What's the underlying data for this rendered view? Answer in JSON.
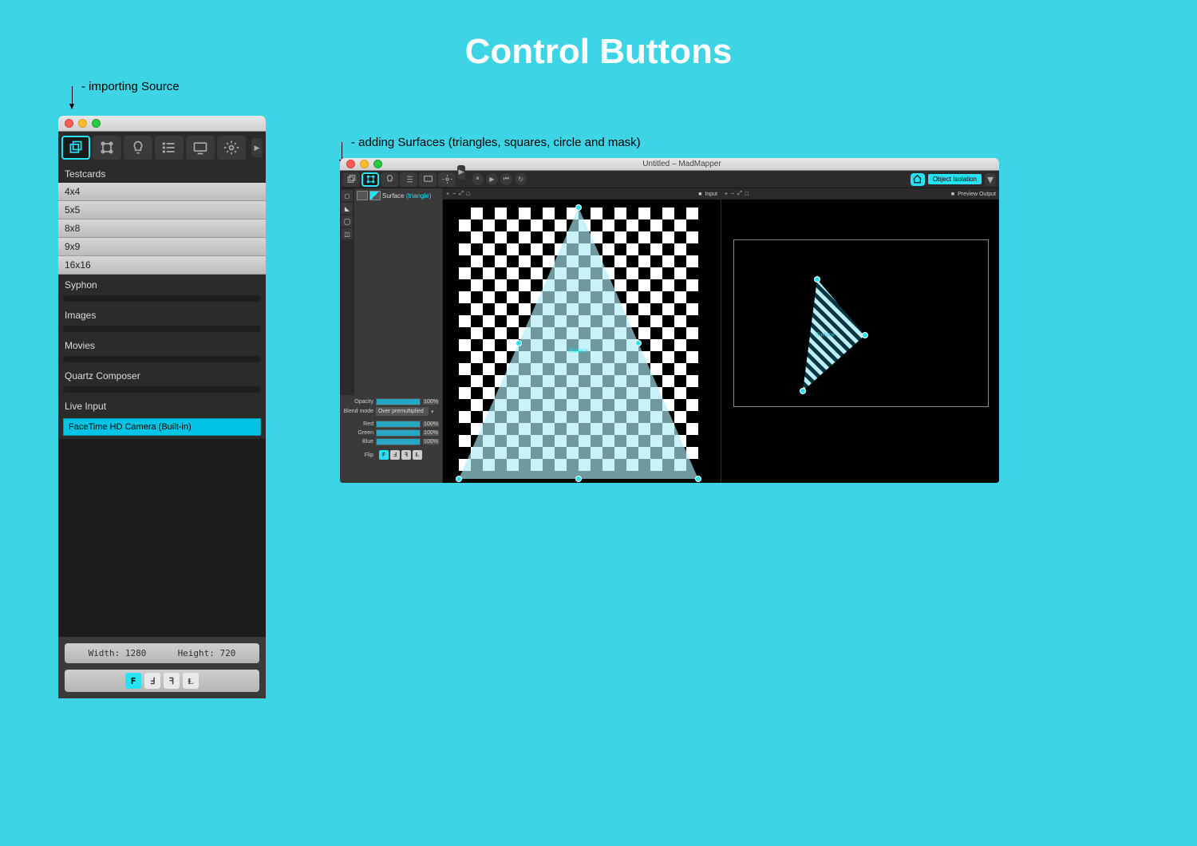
{
  "page_title": "Control Buttons",
  "annotations": {
    "importing": "- importing Source",
    "adding": "- adding Surfaces (triangles, squares, circle and mask)"
  },
  "window1": {
    "toolbar_icons": [
      "layers",
      "transform",
      "light",
      "list",
      "monitor",
      "settings"
    ],
    "sections": {
      "testcards": {
        "label": "Testcards",
        "items": [
          "4x4",
          "5x5",
          "8x8",
          "9x9",
          "16x16"
        ]
      },
      "syphon": {
        "label": "Syphon"
      },
      "images": {
        "label": "Images"
      },
      "movies": {
        "label": "Movies"
      },
      "quartz": {
        "label": "Quartz Composer"
      },
      "live": {
        "label": "Live Input",
        "selected": "FaceTime HD Camera (Built-in)"
      }
    },
    "dim": {
      "width_label": "Width: 1280",
      "height_label": "Height: 720"
    },
    "flip_buttons": [
      "F",
      "Ⅎ",
      "ꟻ",
      "Ɫ"
    ]
  },
  "window2": {
    "title": "Untitled – MadMapper",
    "object_isolation": "Object Isolation",
    "playback": [
      "⏸",
      "▶",
      "⏮",
      "↻"
    ],
    "surface_entry": {
      "name": "Surface",
      "variant": "(triangle)"
    },
    "props": {
      "opacity": {
        "label": "Opacity",
        "value": "100%"
      },
      "blend": {
        "label": "Blend mode",
        "selected": "Over premultiplied"
      },
      "red": {
        "label": "Red",
        "value": "100%"
      },
      "green": {
        "label": "Green",
        "value": "100%"
      },
      "blue": {
        "label": "Blue",
        "value": "100%"
      },
      "flip_label": "Flip",
      "flip_buttons": [
        "F",
        "Ⅎ",
        "ꟻ",
        "Ɫ"
      ]
    },
    "vp_left": {
      "tools": [
        "+",
        "−",
        "⤢",
        "□"
      ],
      "label": "Input"
    },
    "vp_right": {
      "tools": [
        "+",
        "−",
        "⤢",
        "□"
      ],
      "label": "Preview Output"
    },
    "surface_label": "Surface"
  }
}
